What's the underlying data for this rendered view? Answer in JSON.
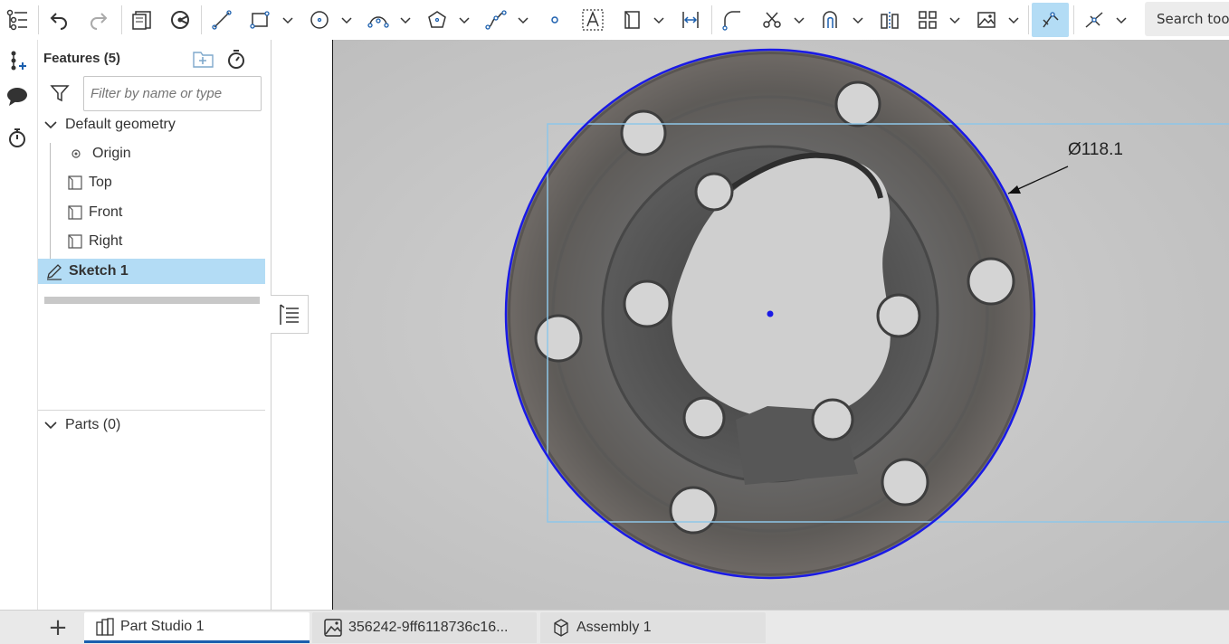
{
  "toolbar": {
    "search_label": "Search tools",
    "tools": [
      {
        "name": "undo-icon"
      },
      {
        "name": "redo-icon"
      },
      {
        "name": "sketch-plane-icon"
      },
      {
        "name": "view-sketch-icon"
      },
      {
        "name": "line-icon"
      },
      {
        "name": "rectangle-icon"
      },
      {
        "name": "circle-icon"
      },
      {
        "name": "arc-icon"
      },
      {
        "name": "polygon-icon"
      },
      {
        "name": "spline-icon"
      },
      {
        "name": "point-icon"
      },
      {
        "name": "text-icon"
      },
      {
        "name": "construction-icon"
      },
      {
        "name": "dimension-icon"
      },
      {
        "name": "fillet-icon"
      },
      {
        "name": "trim-icon"
      },
      {
        "name": "offset-icon"
      },
      {
        "name": "mirror-icon"
      },
      {
        "name": "pattern-icon"
      },
      {
        "name": "image-icon"
      },
      {
        "name": "snap-icon"
      },
      {
        "name": "constraint-icon"
      }
    ]
  },
  "features_panel": {
    "title": "Features (5)",
    "filter_placeholder": "Filter by name or type",
    "default_geometry_label": "Default geometry",
    "items": [
      {
        "label": "Origin",
        "icon": "origin-icon"
      },
      {
        "label": "Top",
        "icon": "plane-icon"
      },
      {
        "label": "Front",
        "icon": "plane-icon"
      },
      {
        "label": "Right",
        "icon": "plane-icon"
      }
    ],
    "sketch_label": "Sketch 1",
    "parts_label": "Parts (0)"
  },
  "viewport": {
    "dimension_label": "Ø118.1",
    "circle_color": "#1a1ae6",
    "bbox_color": "#8ec6e8"
  },
  "tabs": [
    {
      "label": "Part Studio 1",
      "icon": "part-studio-icon",
      "active": true
    },
    {
      "label": "356242-9ff6118736c16...",
      "icon": "image-tab-icon",
      "active": false
    },
    {
      "label": "Assembly 1",
      "icon": "assembly-icon",
      "active": false
    }
  ]
}
